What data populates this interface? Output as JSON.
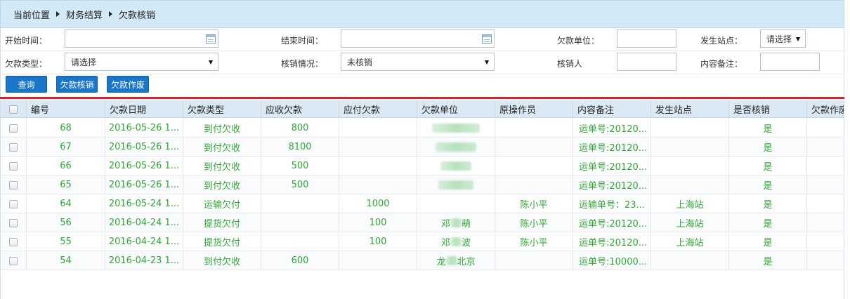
{
  "breadcrumb": {
    "label": "当前位置",
    "items": [
      "财务结算",
      "欠款核销"
    ]
  },
  "filters": {
    "start_time": {
      "label": "开始时间：",
      "value": ""
    },
    "end_time": {
      "label": "结束时间：",
      "value": ""
    },
    "debtor": {
      "label": "欠款单位：",
      "value": ""
    },
    "site": {
      "label": "发生站点：",
      "value": "请选择"
    },
    "debt_type": {
      "label": "欠款类型：",
      "value": "请选择"
    },
    "writeoff_status": {
      "label": "核销情况：",
      "value": "未核销"
    },
    "writeoff_person": {
      "label": "核销人",
      "value": ""
    },
    "remark": {
      "label": "内容备注：",
      "value": ""
    }
  },
  "toolbar": {
    "query": "查询",
    "writeoff": "欠款核销",
    "void": "欠款作废"
  },
  "table": {
    "headers": [
      "编号",
      "欠款日期",
      "欠款类型",
      "应收欠款",
      "应付欠款",
      "欠款单位",
      "原操作员",
      "内容备注",
      "发生站点",
      "是否核销",
      "欠款作废"
    ],
    "rows": [
      {
        "id": "68",
        "date": "2016-05-26 1...",
        "type": "到付欠收",
        "receivable": "800",
        "payable": "",
        "unit": "",
        "operator": "",
        "remark": "运单号:20120...",
        "site": "",
        "written_off": "是"
      },
      {
        "id": "67",
        "date": "2016-05-26 1...",
        "type": "到付欠收",
        "receivable": "8100",
        "payable": "",
        "unit": "",
        "operator": "",
        "remark": "运单号:20120...",
        "site": "",
        "written_off": "是"
      },
      {
        "id": "66",
        "date": "2016-05-26 1...",
        "type": "到付欠收",
        "receivable": "500",
        "payable": "",
        "unit": "",
        "operator": "",
        "remark": "运单号:20120...",
        "site": "",
        "written_off": "是"
      },
      {
        "id": "65",
        "date": "2016-05-26 1...",
        "type": "到付欠收",
        "receivable": "500",
        "payable": "",
        "unit": "",
        "operator": "",
        "remark": "运单号:20120...",
        "site": "",
        "written_off": "是"
      },
      {
        "id": "64",
        "date": "2016-05-24 1...",
        "type": "运输欠付",
        "receivable": "",
        "payable": "1000",
        "unit": "",
        "operator": "陈小平",
        "remark": "运输单号：23...",
        "site": "上海站",
        "written_off": "是"
      },
      {
        "id": "56",
        "date": "2016-04-24 1...",
        "type": "提货欠付",
        "receivable": "",
        "payable": "100",
        "unit": "邓",
        "unit_tail": "萌",
        "operator": "陈小平",
        "remark": "运单号:20120...",
        "site": "上海站",
        "written_off": "是"
      },
      {
        "id": "55",
        "date": "2016-04-24 1...",
        "type": "提货欠付",
        "receivable": "",
        "payable": "100",
        "unit": "邓",
        "unit_tail": "波",
        "operator": "陈小平",
        "remark": "运单号:20120...",
        "site": "上海站",
        "written_off": "是"
      },
      {
        "id": "54",
        "date": "2016-04-23 1...",
        "type": "到付欠收",
        "receivable": "600",
        "payable": "",
        "unit": "龙",
        "unit_tail": "北京",
        "operator": "",
        "remark": "运单号:10000...",
        "site": "",
        "written_off": "是"
      }
    ]
  }
}
